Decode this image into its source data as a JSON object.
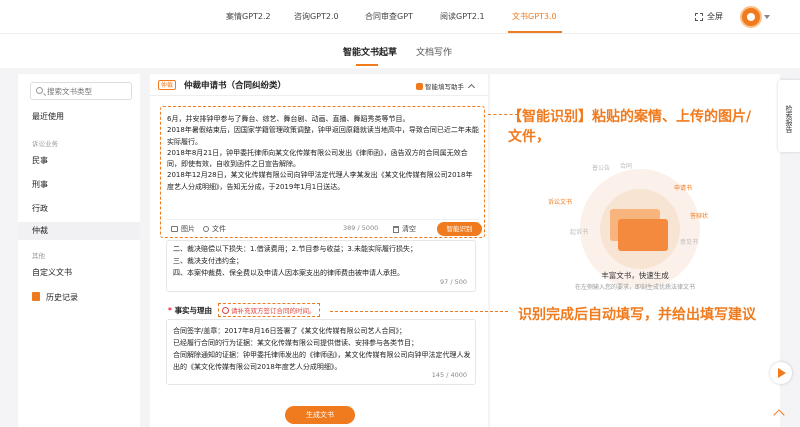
{
  "nav": {
    "tabs": [
      {
        "label": "案情GPT2.2"
      },
      {
        "label": "咨询GPT2.0"
      },
      {
        "label": "合同审查GPT"
      },
      {
        "label": "阅读GPT2.1"
      },
      {
        "label": "文书GPT3.0"
      }
    ],
    "active_tab": "文书GPT3.0",
    "fullscreen_label": "全屏",
    "accent_color": "#f07b1f"
  },
  "subnav": {
    "tabs": [
      {
        "label": "智能文书起草"
      },
      {
        "label": "文档写作"
      }
    ],
    "active_tab": "智能文书起草"
  },
  "sidebar": {
    "search_placeholder": "搜索文书类型",
    "recent": "最近使用",
    "group_litigation": "诉讼业务",
    "items": [
      {
        "label": "民事"
      },
      {
        "label": "刑事"
      },
      {
        "label": "行政"
      },
      {
        "label": "仲裁"
      }
    ],
    "active_item": "仲裁",
    "group_other": "其他",
    "custom": "自定义文书",
    "history": "历史记录"
  },
  "document": {
    "badge": "仲裁",
    "title": "仲裁申请书（合同纠纷类）",
    "assistant_label": "智能填写助手",
    "paste_text": [
      "6月，并安排钟甲参与了舞台、综艺、舞台剧、动画、直播、舞蹈秀类等节目。",
      "2018年暑假结束后，因国家学籍管理政策调整，钟甲返回原籍就读当地高中，导致合同已近二年未能实际履行。",
      "2018年8月21日，钟甲委托律师向某文化传媒有限公司发出《律师函》，函告双方的合同属无效合同，即使有效，自收到函件之日宣告解除。",
      "2018年12月28日，某文化传媒有限公司向钟甲法定代理人李某发出《某文化传媒有限公司2018年度艺人分成明细》，告知无分成，于2019年1月1日送达。"
    ],
    "image_btn": "图片",
    "file_btn": "文件",
    "paste_count": "389 / 5000",
    "clear_btn": "清空",
    "identify_btn": "智能识别",
    "claims_lines": [
      "二、裁决赔偿以下损失：1.借读费用；2.节目参与收益；3.未能实际履行损失；",
      "三、裁决支付违约金；",
      "四、本案仲裁费、保全费以及申请人因本案支出的律师费由被申请人承担。"
    ],
    "claims_count": "97 / 500",
    "facts_star": "*",
    "facts_label": "事实与理由",
    "facts_warning": "请补充双方签订合同的时间。",
    "facts_lines": [
      "合同签字/盖章：2017年8月16日签署了《某文化传媒有限公司艺人合同》；",
      "已经履行合同的行为证据：某文化传媒有限公司提供借读、安排参与各类节目；",
      "合同解除通知的证据：钟甲委托律师发出的《律师函》，某文化传媒有限公司向钟甲法定代理人发出的《某文化传媒有限公司2018年度艺人分成明细》。"
    ],
    "facts_count": "145 / 4000",
    "generate_btn": "生成文书"
  },
  "right_panel": {
    "labels": [
      "诉讼文书",
      "合同",
      "普公告",
      "申请书",
      "答辩状",
      "起诉书",
      "意见书"
    ],
    "title": "丰富文书，快速生成",
    "subtitle": "在左侧输入您的要求，即刻生成优质法律文书"
  },
  "annotations": {
    "first": "【智能识别】粘贴的案情、上传的图片/文件，",
    "second": "识别完成后自动填写，并给出填写建议"
  },
  "feedback_tab": "检索报告"
}
